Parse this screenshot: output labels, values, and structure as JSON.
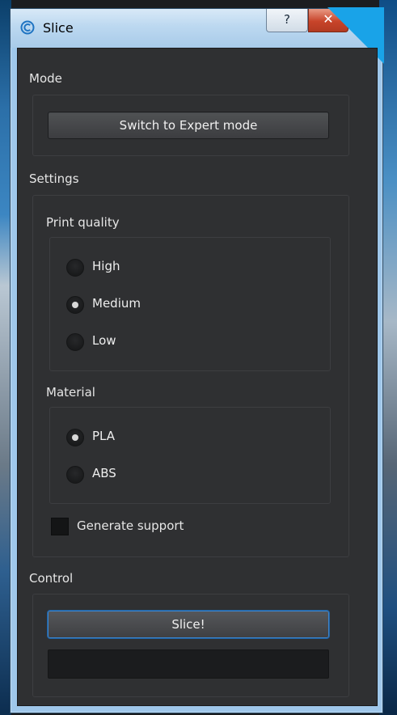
{
  "window": {
    "title": "Slice",
    "help_label": "?",
    "close_label": "✕"
  },
  "mode": {
    "label": "Mode",
    "button_label": "Switch to Expert mode"
  },
  "settings": {
    "label": "Settings",
    "print_quality": {
      "label": "Print quality",
      "options": [
        {
          "label": "High",
          "selected": false
        },
        {
          "label": "Medium",
          "selected": true
        },
        {
          "label": "Low",
          "selected": false
        }
      ]
    },
    "material": {
      "label": "Material",
      "options": [
        {
          "label": "PLA",
          "selected": true
        },
        {
          "label": "ABS",
          "selected": false
        }
      ]
    },
    "generate_support": {
      "label": "Generate support",
      "checked": false
    }
  },
  "control": {
    "label": "Control",
    "slice_label": "Slice!",
    "progress": 0
  },
  "colors": {
    "accent": "#3d86cf",
    "panel": "#2f3032",
    "titlebar": "#bcd8f0"
  }
}
